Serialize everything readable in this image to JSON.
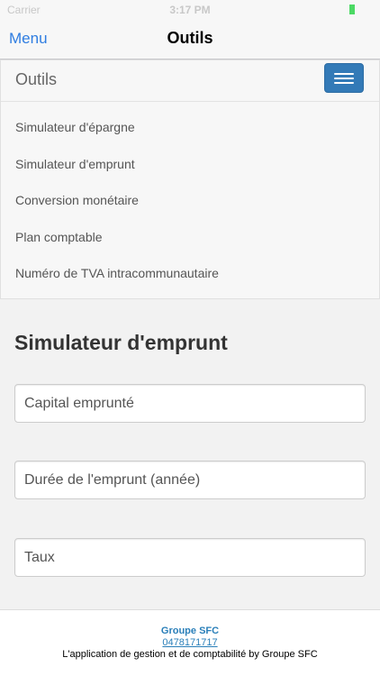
{
  "status_bar": {
    "carrier": "Carrier",
    "time": "3:17 PM"
  },
  "navbar": {
    "back_label": "Menu",
    "title": "Outils"
  },
  "site_nav": {
    "brand": "Outils",
    "items": [
      {
        "label": "Simulateur d'épargne"
      },
      {
        "label": "Simulateur d'emprunt"
      },
      {
        "label": "Conversion monétaire"
      },
      {
        "label": "Plan comptable"
      },
      {
        "label": "Numéro de TVA intracommunautaire"
      }
    ]
  },
  "form": {
    "title": "Simulateur d'emprunt",
    "fields": [
      {
        "placeholder": "Capital emprunté",
        "value": ""
      },
      {
        "placeholder": "Durée de l'emprunt (année)",
        "value": ""
      },
      {
        "placeholder": "Taux",
        "value": ""
      }
    ]
  },
  "footer": {
    "company": "Groupe SFC",
    "phone": "0478171717",
    "tagline": "L'application de gestion et de comptabilité by Groupe SFC"
  },
  "colors": {
    "accent": "#2f7de1",
    "button": "#337ab7",
    "battery": "#4cd964",
    "footer_link": "#2a7fb9"
  }
}
